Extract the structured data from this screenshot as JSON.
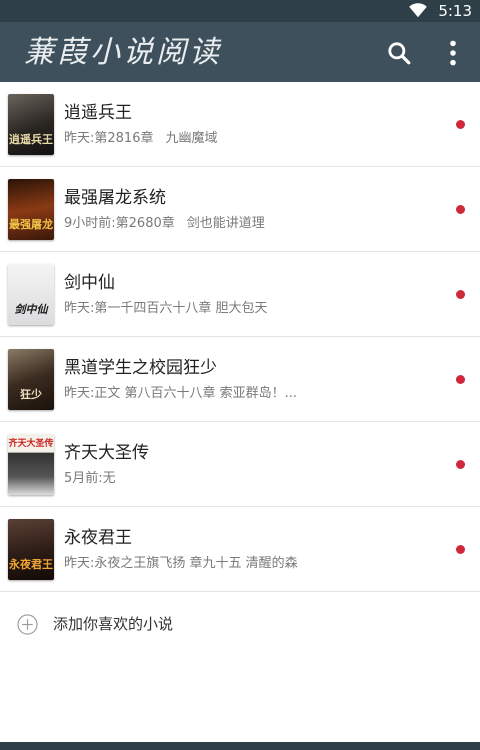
{
  "status_bar": {
    "time": "5:13",
    "wifi_icon": "wifi-icon"
  },
  "app_bar": {
    "title": "蒹葭小说阅读",
    "search_icon": "search-icon",
    "menu_icon": "more-vert-icon"
  },
  "colors": {
    "app_bar": "#3d505b",
    "status_bar": "#2f3f48",
    "unread_dot": "#d0283b"
  },
  "books": [
    {
      "title": "逍遥兵王",
      "update": "昨天:第2816章",
      "chapter": "九幽魔域",
      "cover_text": "逍遥兵王",
      "cover_bg": "#2a2622",
      "cover_fg": "#e8d9a8",
      "unread": true
    },
    {
      "title": "最强屠龙系统",
      "update": "9小时前:第2680章",
      "chapter": "剑也能讲道理",
      "cover_text": "最强屠龙",
      "cover_bg": "#5a2a14",
      "cover_fg": "#f2c24a",
      "unread": true
    },
    {
      "title": "剑中仙",
      "update": "昨天:第一千四百六十八章 胆大包天",
      "chapter": "",
      "cover_text": "剑中仙",
      "cover_bg": "#e9e9ea",
      "cover_fg": "#1d1d1d",
      "unread": true
    },
    {
      "title": "黑道学生之校园狂少",
      "update": "昨天:正文 第八百六十八章 索亚群岛！...",
      "chapter": "",
      "cover_text": "狂少",
      "cover_bg": "#3a2b1f",
      "cover_fg": "#f0e0c0",
      "unread": true
    },
    {
      "title": "齐天大圣传",
      "update": "5月前:无",
      "chapter": "",
      "cover_text": "齐天大圣传",
      "cover_bg": "#f4f1ea",
      "cover_fg": "#c8231f",
      "unread": true
    },
    {
      "title": "永夜君王",
      "update": "昨天:永夜之王旗飞扬 章九十五 清醒的森",
      "chapter": "",
      "cover_text": "永夜君王",
      "cover_bg": "#2c1c16",
      "cover_fg": "#f3a531",
      "unread": true
    }
  ],
  "add_novel": {
    "label": "添加你喜欢的小说",
    "icon": "add-circle-icon"
  }
}
